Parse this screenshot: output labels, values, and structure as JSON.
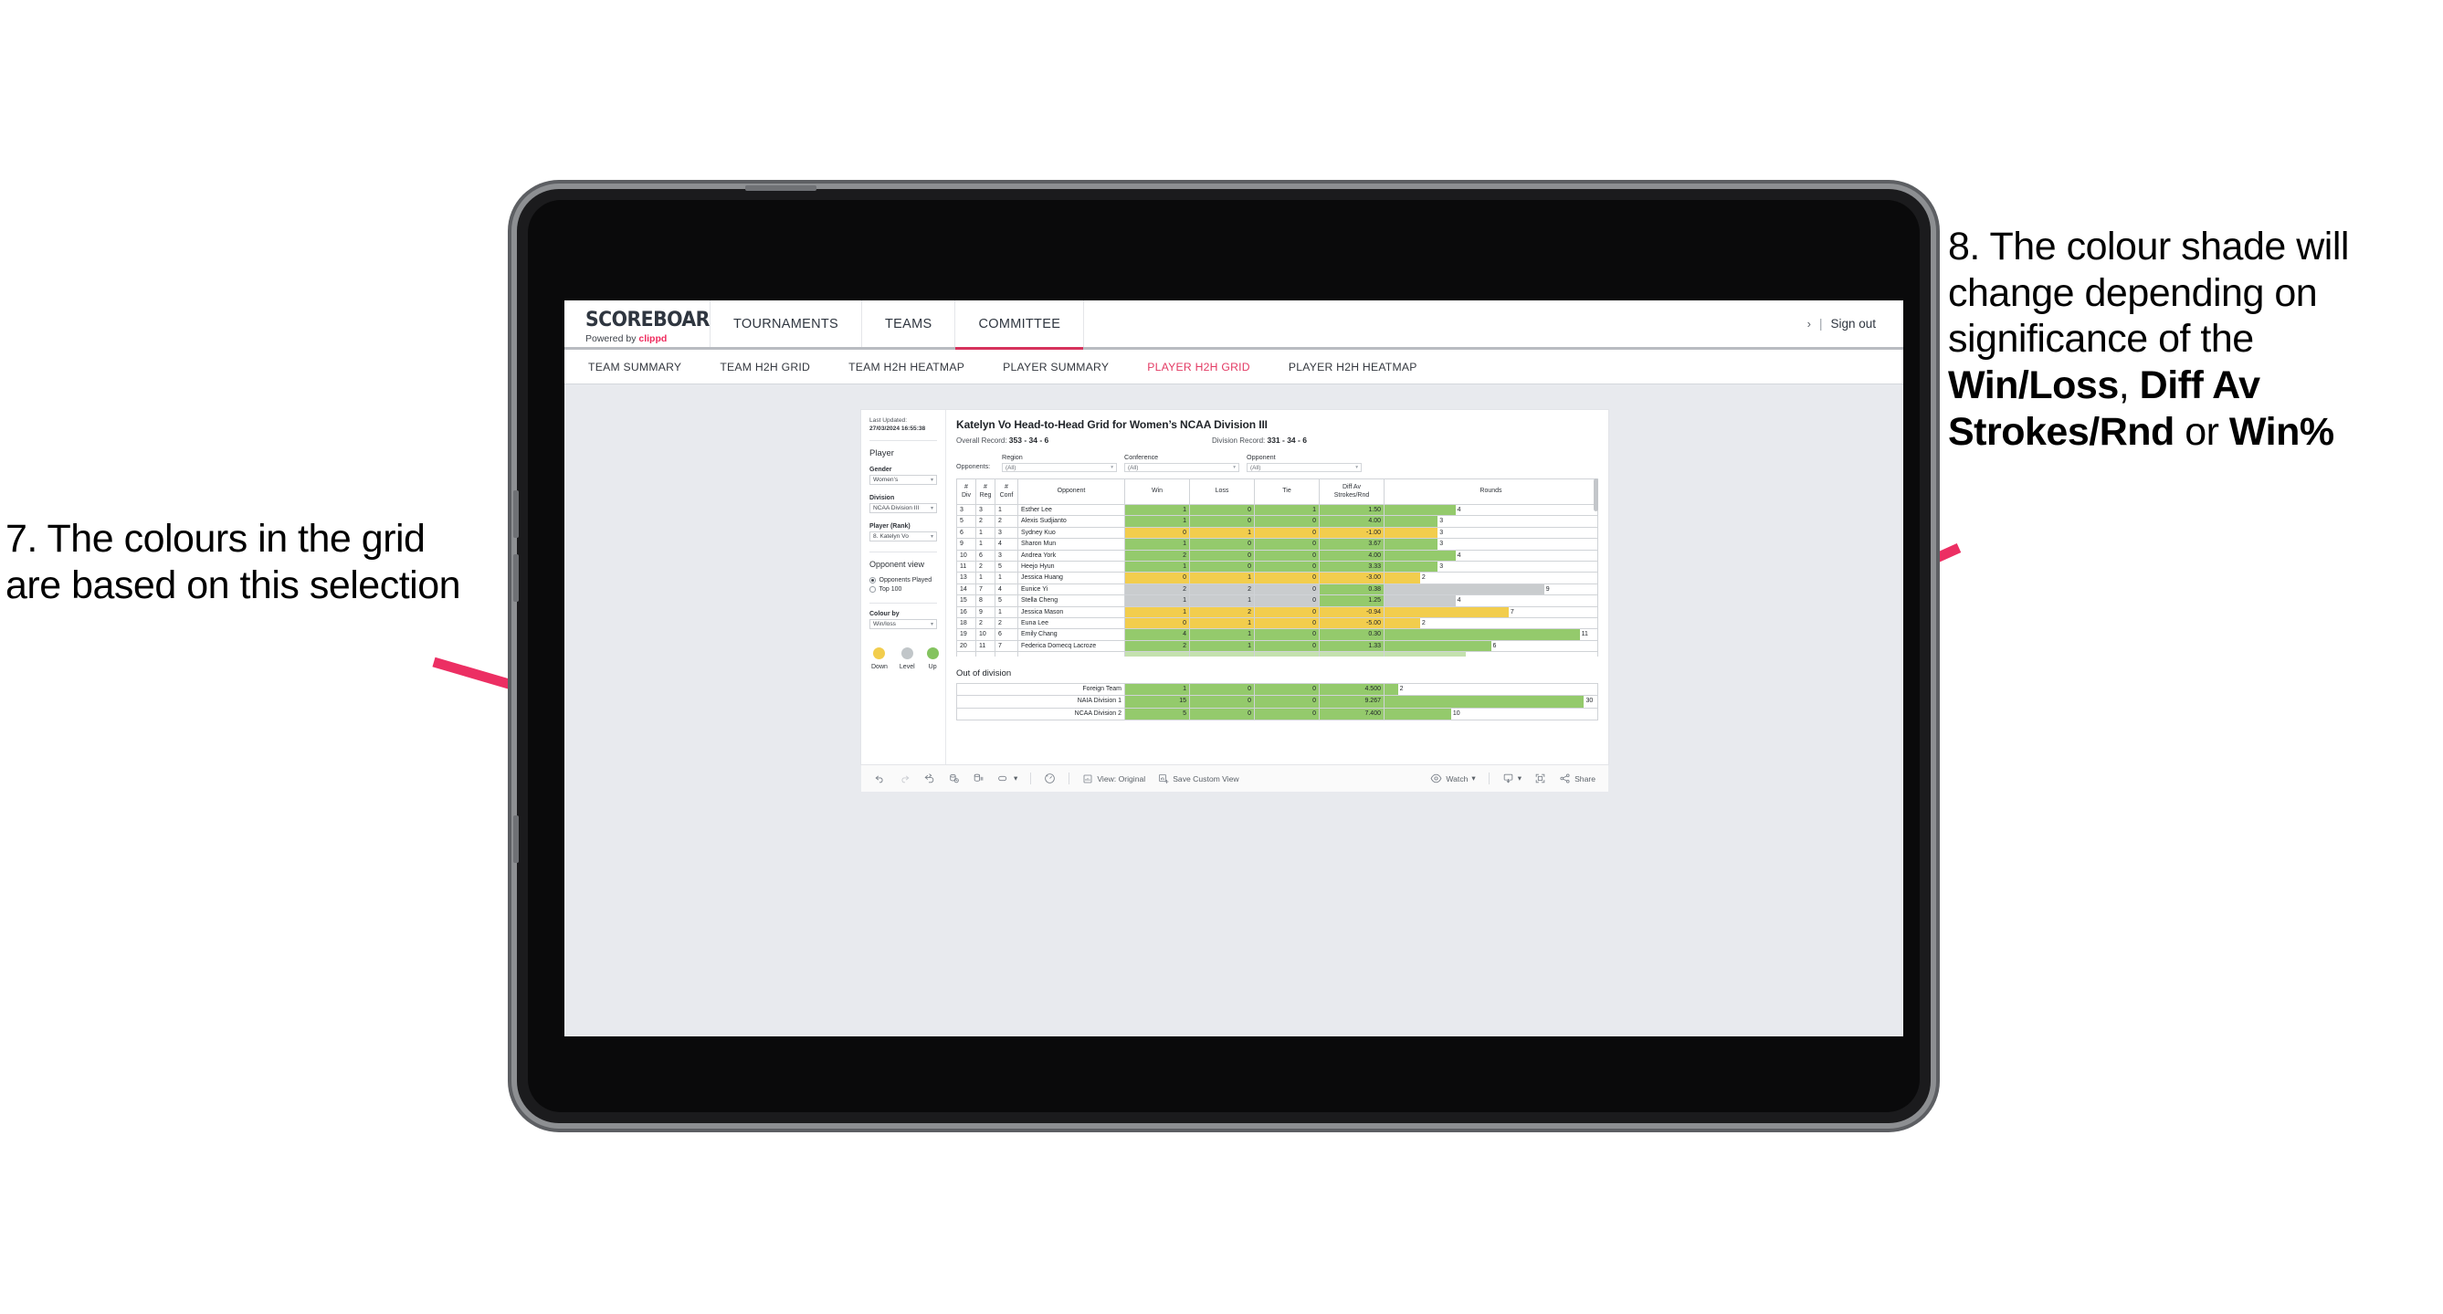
{
  "annotations": {
    "left": "7. The colours in the grid are based on this selection",
    "right_pre": "8. The colour shade will change depending on significance of the ",
    "right_b1": "Win/Loss",
    "right_mid1": ", ",
    "right_b2": "Diff Av Strokes/Rnd",
    "right_mid2": " or ",
    "right_b3": "Win%",
    "arrow_color": "#ec2f63"
  },
  "topnav": {
    "brand_title": "SCOREBOARD",
    "brand_sub_prefix": "Powered by ",
    "brand_sub_accent": "clippd",
    "items": [
      {
        "label": "TOURNAMENTS",
        "active": false
      },
      {
        "label": "TEAMS",
        "active": false
      },
      {
        "label": "COMMITTEE",
        "active": true
      }
    ],
    "chevron": "›",
    "separator": "|",
    "sign_out": "Sign out"
  },
  "subnav": {
    "items": [
      {
        "label": "TEAM SUMMARY",
        "active": false
      },
      {
        "label": "TEAM H2H GRID",
        "active": false
      },
      {
        "label": "TEAM H2H HEATMAP",
        "active": false
      },
      {
        "label": "PLAYER SUMMARY",
        "active": false
      },
      {
        "label": "PLAYER H2H GRID",
        "active": true
      },
      {
        "label": "PLAYER H2H HEATMAP",
        "active": false
      }
    ]
  },
  "rail": {
    "last_updated_label": "Last Updated: ",
    "last_updated_value": "27/03/2024 16:55:38",
    "player_heading": "Player",
    "gender_label": "Gender",
    "gender_value": "Women’s",
    "division_label": "Division",
    "division_value": "NCAA Division III",
    "player_rank_label": "Player (Rank)",
    "player_rank_value": "8. Katelyn Vo",
    "opponent_view_heading": "Opponent view",
    "opponent_view_options": [
      {
        "label": "Opponents Played",
        "selected": true
      },
      {
        "label": "Top 100",
        "selected": false
      }
    ],
    "colour_by_label": "Colour by",
    "colour_by_value": "Win/loss",
    "legend": [
      {
        "label": "Down",
        "color": "#f2cd4d"
      },
      {
        "label": "Level",
        "color": "#c1c6c9"
      },
      {
        "label": "Up",
        "color": "#84c35f"
      }
    ],
    "caret": "▾"
  },
  "viz": {
    "title": "Katelyn Vo Head-to-Head Grid for Women’s NCAA Division III",
    "overall_record_label": "Overall Record: ",
    "overall_record_value": "353 -  34 - 6",
    "division_record_label": "Division Record: ",
    "division_record_value": "331 -  34 - 6",
    "opponents_label": "Opponents:",
    "filters": [
      {
        "title": "Region",
        "value": "(All)"
      },
      {
        "title": "Conference",
        "value": "(All)"
      },
      {
        "title": "Opponent",
        "value": "(All)"
      }
    ],
    "caret": "▾"
  },
  "chart_data": {
    "type": "table",
    "title": "Katelyn Vo Head-to-Head Grid for Women’s NCAA Division III",
    "columns": [
      "# Div",
      "# Reg",
      "# Conf",
      "Opponent",
      "Win",
      "Loss",
      "Tie",
      "Diff Av Strokes/Rnd",
      "Rounds"
    ],
    "column_header_lines": [
      [
        "#",
        "Div"
      ],
      [
        "#",
        "Reg"
      ],
      [
        "#",
        "Conf"
      ],
      [
        "Opponent"
      ],
      [
        "Win"
      ],
      [
        "Loss"
      ],
      [
        "Tie"
      ],
      [
        "Diff Av",
        "Strokes/Rnd"
      ],
      [
        "Rounds"
      ]
    ],
    "rounds_max": 12,
    "rows": [
      {
        "div": "3",
        "reg": "3",
        "conf": "1",
        "opponent": "Esther Lee",
        "win": "1",
        "loss": "0",
        "tie": "1",
        "diff": "1.50",
        "rounds": "4",
        "shade": "g"
      },
      {
        "div": "5",
        "reg": "2",
        "conf": "2",
        "opponent": "Alexis Sudjianto",
        "win": "1",
        "loss": "0",
        "tie": "0",
        "diff": "4.00",
        "rounds": "3",
        "shade": "g"
      },
      {
        "div": "6",
        "reg": "1",
        "conf": "3",
        "opponent": "Sydney Kuo",
        "win": "0",
        "loss": "1",
        "tie": "0",
        "diff": "-1.00",
        "rounds": "3",
        "shade": "y"
      },
      {
        "div": "9",
        "reg": "1",
        "conf": "4",
        "opponent": "Sharon Mun",
        "win": "1",
        "loss": "0",
        "tie": "0",
        "diff": "3.67",
        "rounds": "3",
        "shade": "g"
      },
      {
        "div": "10",
        "reg": "6",
        "conf": "3",
        "opponent": "Andrea York",
        "win": "2",
        "loss": "0",
        "tie": "0",
        "diff": "4.00",
        "rounds": "4",
        "shade": "g"
      },
      {
        "div": "11",
        "reg": "2",
        "conf": "5",
        "opponent": "Heejo Hyun",
        "win": "1",
        "loss": "0",
        "tie": "0",
        "diff": "3.33",
        "rounds": "3",
        "shade": "g"
      },
      {
        "div": "13",
        "reg": "1",
        "conf": "1",
        "opponent": "Jessica Huang",
        "win": "0",
        "loss": "1",
        "tie": "0",
        "diff": "-3.00",
        "rounds": "2",
        "shade": "y"
      },
      {
        "div": "14",
        "reg": "7",
        "conf": "4",
        "opponent": "Eunice Yi",
        "win": "2",
        "loss": "2",
        "tie": "0",
        "diff": "0.38",
        "rounds": "9",
        "shade": "s",
        "diff_shade": "g"
      },
      {
        "div": "15",
        "reg": "8",
        "conf": "5",
        "opponent": "Stella Cheng",
        "win": "1",
        "loss": "1",
        "tie": "0",
        "diff": "1.25",
        "rounds": "4",
        "shade": "s",
        "diff_shade": "g"
      },
      {
        "div": "16",
        "reg": "9",
        "conf": "1",
        "opponent": "Jessica Mason",
        "win": "1",
        "loss": "2",
        "tie": "0",
        "diff": "-0.94",
        "rounds": "7",
        "shade": "y"
      },
      {
        "div": "18",
        "reg": "2",
        "conf": "2",
        "opponent": "Euna Lee",
        "win": "0",
        "loss": "1",
        "tie": "0",
        "diff": "-5.00",
        "rounds": "2",
        "shade": "y"
      },
      {
        "div": "19",
        "reg": "10",
        "conf": "6",
        "opponent": "Emily Chang",
        "win": "4",
        "loss": "1",
        "tie": "0",
        "diff": "0.30",
        "rounds": "11",
        "shade": "g"
      },
      {
        "div": "20",
        "reg": "11",
        "conf": "7",
        "opponent": "Federica Domecq Lacroze",
        "win": "2",
        "loss": "1",
        "tie": "0",
        "diff": "1.33",
        "rounds": "6",
        "shade": "g"
      }
    ],
    "out_of_division_title": "Out of division",
    "out_of_division_rounds_max": 32,
    "out_of_division": [
      {
        "name": "Foreign Team",
        "win": "1",
        "loss": "0",
        "tie": "0",
        "diff": "4.500",
        "rounds": "2",
        "shade": "g"
      },
      {
        "name": "NAIA Division 1",
        "win": "15",
        "loss": "0",
        "tie": "0",
        "diff": "9.267",
        "rounds": "30",
        "shade": "g"
      },
      {
        "name": "NCAA Division 2",
        "win": "5",
        "loss": "0",
        "tie": "0",
        "diff": "7.400",
        "rounds": "10",
        "shade": "g"
      }
    ]
  },
  "toolbar": {
    "view_original": "View: Original",
    "save_custom_view": "Save Custom View",
    "watch": "Watch",
    "share": "Share",
    "caret": "▾"
  }
}
